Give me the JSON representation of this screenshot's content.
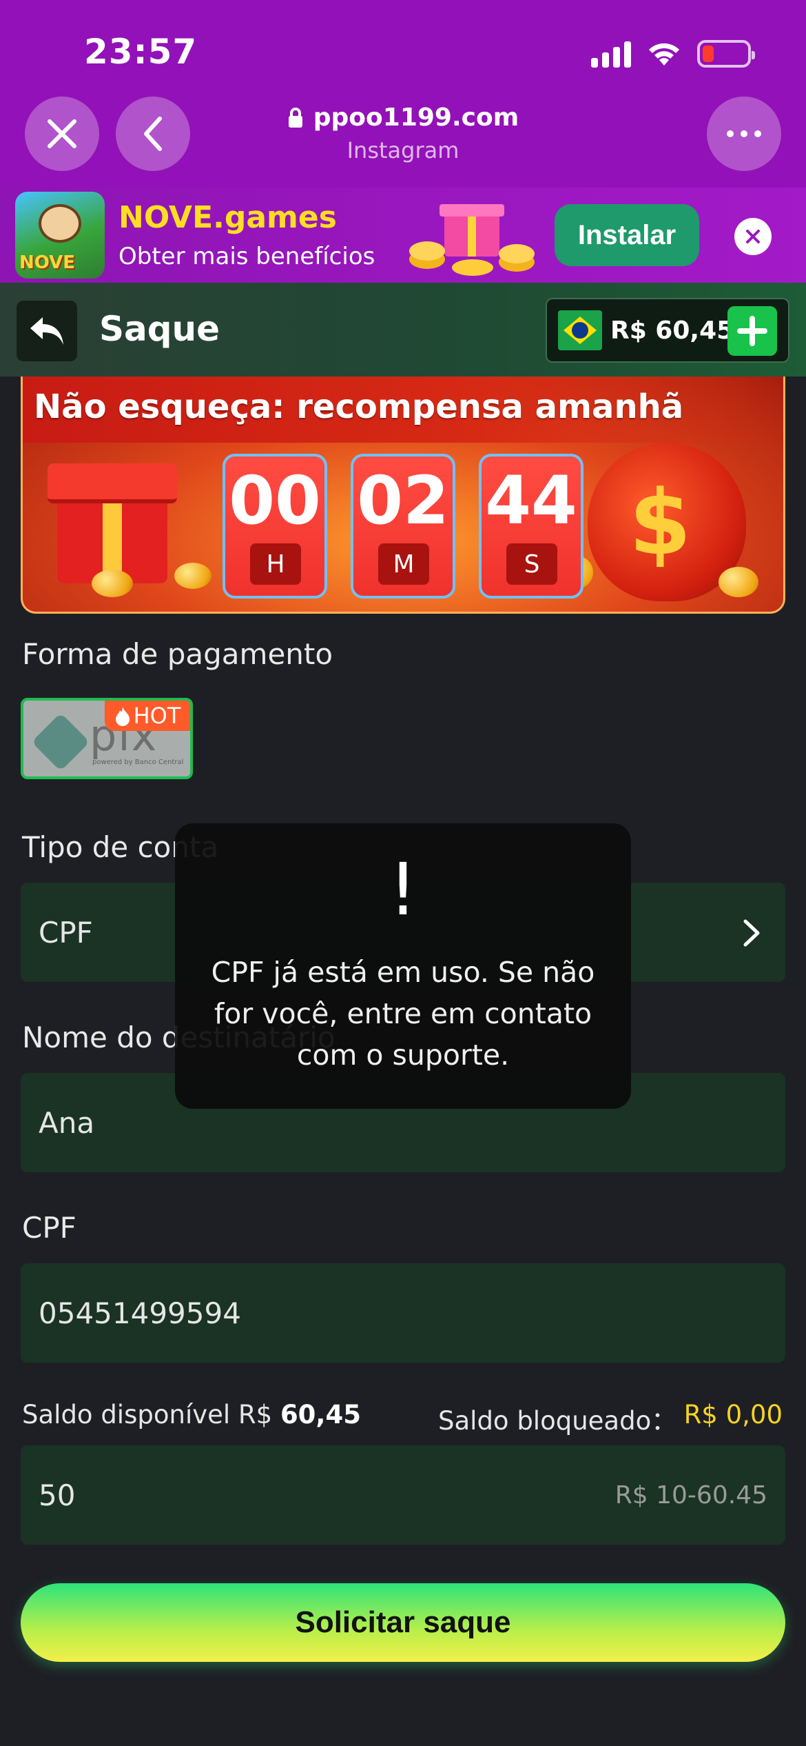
{
  "status_bar": {
    "time": "23:57"
  },
  "browser": {
    "url": "ppoo1199.com",
    "source": "Instagram",
    "close_icon": "close-icon",
    "back_icon": "chevron-left-icon",
    "menu_icon": "more-dots-icon"
  },
  "install_banner": {
    "logo_text": "NOVE",
    "title": "NOVE.games",
    "subtitle": "Obter mais benefícios",
    "install_label": "Instalar"
  },
  "header": {
    "title": "Saque",
    "balance": "R$ 60,45"
  },
  "promo": {
    "title": "Não esqueça: recompensa amanhã",
    "countdown": [
      {
        "value": "00",
        "unit": "H"
      },
      {
        "value": "02",
        "unit": "M"
      },
      {
        "value": "44",
        "unit": "S"
      }
    ]
  },
  "payment": {
    "label": "Forma de pagamento",
    "method_text": "pix",
    "method_subtext": "powered by Banco Central",
    "hot_badge": "HOT"
  },
  "account_type": {
    "label": "Tipo de conta",
    "value": "CPF"
  },
  "recipient": {
    "label": "Nome do destinatário",
    "value": "Ana"
  },
  "cpf": {
    "label": "CPF",
    "value": "05451499594"
  },
  "balances": {
    "available_label": "Saldo disponível R$",
    "available_value": "60,45",
    "blocked_label": "Saldo bloqueado：",
    "blocked_value": "R$ 0,00"
  },
  "amount": {
    "value": "50",
    "hint": "R$ 10-60.45"
  },
  "submit_label": "Solicitar saque",
  "toast": {
    "mark": "!",
    "message": "CPF já está em uso. Se não for você, entre em contato com o suporte."
  },
  "colors": {
    "chrome": "#9311b8",
    "accent_green": "#19c24a",
    "field_bg": "#1a3324",
    "page_bg": "#1e1f24",
    "gold": "#f7d323"
  }
}
